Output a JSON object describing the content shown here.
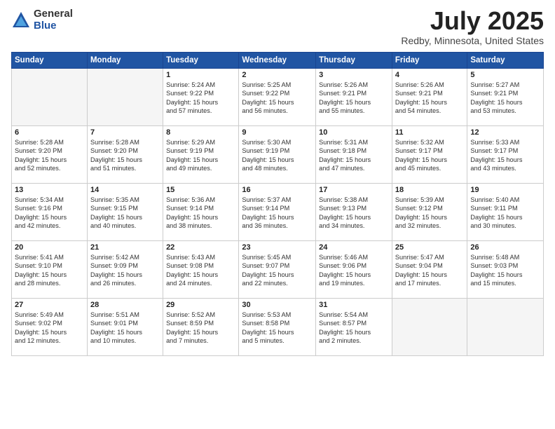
{
  "logo": {
    "general": "General",
    "blue": "Blue"
  },
  "title": "July 2025",
  "subtitle": "Redby, Minnesota, United States",
  "weekdays": [
    "Sunday",
    "Monday",
    "Tuesday",
    "Wednesday",
    "Thursday",
    "Friday",
    "Saturday"
  ],
  "weeks": [
    [
      {
        "day": "",
        "info": ""
      },
      {
        "day": "",
        "info": ""
      },
      {
        "day": "1",
        "info": "Sunrise: 5:24 AM\nSunset: 9:22 PM\nDaylight: 15 hours\nand 57 minutes."
      },
      {
        "day": "2",
        "info": "Sunrise: 5:25 AM\nSunset: 9:22 PM\nDaylight: 15 hours\nand 56 minutes."
      },
      {
        "day": "3",
        "info": "Sunrise: 5:26 AM\nSunset: 9:21 PM\nDaylight: 15 hours\nand 55 minutes."
      },
      {
        "day": "4",
        "info": "Sunrise: 5:26 AM\nSunset: 9:21 PM\nDaylight: 15 hours\nand 54 minutes."
      },
      {
        "day": "5",
        "info": "Sunrise: 5:27 AM\nSunset: 9:21 PM\nDaylight: 15 hours\nand 53 minutes."
      }
    ],
    [
      {
        "day": "6",
        "info": "Sunrise: 5:28 AM\nSunset: 9:20 PM\nDaylight: 15 hours\nand 52 minutes."
      },
      {
        "day": "7",
        "info": "Sunrise: 5:28 AM\nSunset: 9:20 PM\nDaylight: 15 hours\nand 51 minutes."
      },
      {
        "day": "8",
        "info": "Sunrise: 5:29 AM\nSunset: 9:19 PM\nDaylight: 15 hours\nand 49 minutes."
      },
      {
        "day": "9",
        "info": "Sunrise: 5:30 AM\nSunset: 9:19 PM\nDaylight: 15 hours\nand 48 minutes."
      },
      {
        "day": "10",
        "info": "Sunrise: 5:31 AM\nSunset: 9:18 PM\nDaylight: 15 hours\nand 47 minutes."
      },
      {
        "day": "11",
        "info": "Sunrise: 5:32 AM\nSunset: 9:17 PM\nDaylight: 15 hours\nand 45 minutes."
      },
      {
        "day": "12",
        "info": "Sunrise: 5:33 AM\nSunset: 9:17 PM\nDaylight: 15 hours\nand 43 minutes."
      }
    ],
    [
      {
        "day": "13",
        "info": "Sunrise: 5:34 AM\nSunset: 9:16 PM\nDaylight: 15 hours\nand 42 minutes."
      },
      {
        "day": "14",
        "info": "Sunrise: 5:35 AM\nSunset: 9:15 PM\nDaylight: 15 hours\nand 40 minutes."
      },
      {
        "day": "15",
        "info": "Sunrise: 5:36 AM\nSunset: 9:14 PM\nDaylight: 15 hours\nand 38 minutes."
      },
      {
        "day": "16",
        "info": "Sunrise: 5:37 AM\nSunset: 9:14 PM\nDaylight: 15 hours\nand 36 minutes."
      },
      {
        "day": "17",
        "info": "Sunrise: 5:38 AM\nSunset: 9:13 PM\nDaylight: 15 hours\nand 34 minutes."
      },
      {
        "day": "18",
        "info": "Sunrise: 5:39 AM\nSunset: 9:12 PM\nDaylight: 15 hours\nand 32 minutes."
      },
      {
        "day": "19",
        "info": "Sunrise: 5:40 AM\nSunset: 9:11 PM\nDaylight: 15 hours\nand 30 minutes."
      }
    ],
    [
      {
        "day": "20",
        "info": "Sunrise: 5:41 AM\nSunset: 9:10 PM\nDaylight: 15 hours\nand 28 minutes."
      },
      {
        "day": "21",
        "info": "Sunrise: 5:42 AM\nSunset: 9:09 PM\nDaylight: 15 hours\nand 26 minutes."
      },
      {
        "day": "22",
        "info": "Sunrise: 5:43 AM\nSunset: 9:08 PM\nDaylight: 15 hours\nand 24 minutes."
      },
      {
        "day": "23",
        "info": "Sunrise: 5:45 AM\nSunset: 9:07 PM\nDaylight: 15 hours\nand 22 minutes."
      },
      {
        "day": "24",
        "info": "Sunrise: 5:46 AM\nSunset: 9:06 PM\nDaylight: 15 hours\nand 19 minutes."
      },
      {
        "day": "25",
        "info": "Sunrise: 5:47 AM\nSunset: 9:04 PM\nDaylight: 15 hours\nand 17 minutes."
      },
      {
        "day": "26",
        "info": "Sunrise: 5:48 AM\nSunset: 9:03 PM\nDaylight: 15 hours\nand 15 minutes."
      }
    ],
    [
      {
        "day": "27",
        "info": "Sunrise: 5:49 AM\nSunset: 9:02 PM\nDaylight: 15 hours\nand 12 minutes."
      },
      {
        "day": "28",
        "info": "Sunrise: 5:51 AM\nSunset: 9:01 PM\nDaylight: 15 hours\nand 10 minutes."
      },
      {
        "day": "29",
        "info": "Sunrise: 5:52 AM\nSunset: 8:59 PM\nDaylight: 15 hours\nand 7 minutes."
      },
      {
        "day": "30",
        "info": "Sunrise: 5:53 AM\nSunset: 8:58 PM\nDaylight: 15 hours\nand 5 minutes."
      },
      {
        "day": "31",
        "info": "Sunrise: 5:54 AM\nSunset: 8:57 PM\nDaylight: 15 hours\nand 2 minutes."
      },
      {
        "day": "",
        "info": ""
      },
      {
        "day": "",
        "info": ""
      }
    ]
  ]
}
